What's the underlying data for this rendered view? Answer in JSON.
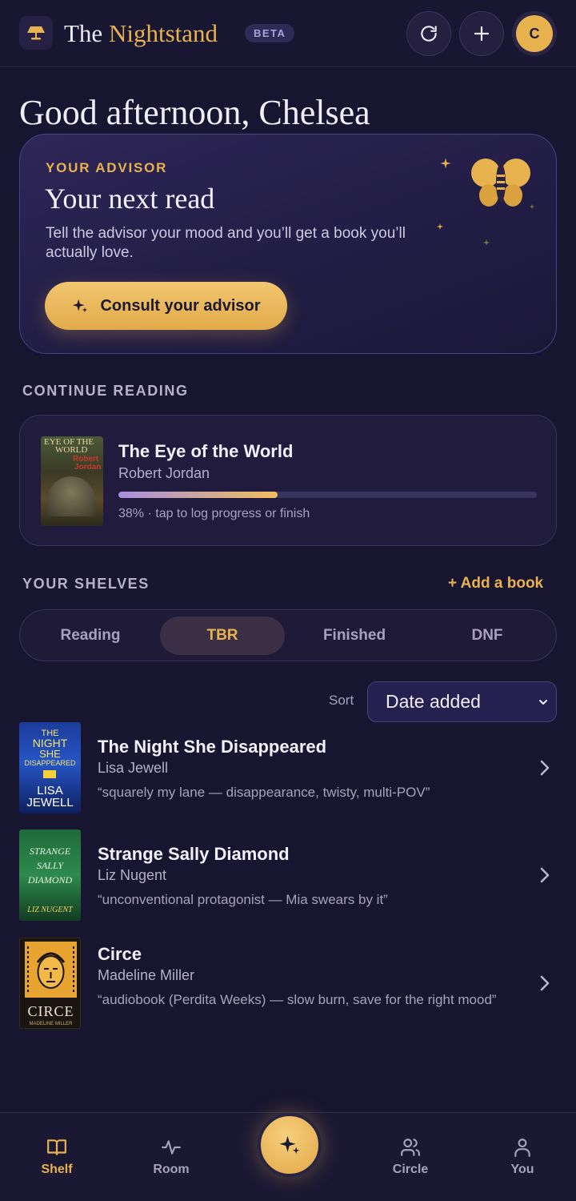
{
  "header": {
    "brand_prefix": "The",
    "brand_accent": "Nightstand",
    "badge": "BETA",
    "avatar_initial": "C",
    "icons": [
      "lamp-icon",
      "refresh-icon",
      "plus-icon"
    ]
  },
  "greeting": "Good afternoon, Chelsea",
  "advisor": {
    "eyebrow": "YOUR ADVISOR",
    "title": "Your next read",
    "description": "Tell the advisor your mood and you’ll get a book you’ll actually love.",
    "button_label": "Consult your advisor"
  },
  "continue_reading": {
    "section_label": "CONTINUE READING",
    "title": "The Eye of the World",
    "author": "Robert Jordan",
    "progress": 0.38,
    "note": "38% · tap to log progress or finish",
    "cover_text": [
      "EYE OF THE",
      "WORLD",
      "Robert",
      "Jordan"
    ]
  },
  "shelves": {
    "section_label": "YOUR SHELVES",
    "add_label": "+ Add a book",
    "tabs": [
      "Reading",
      "TBR",
      "Finished",
      "DNF"
    ],
    "active_tab": "TBR",
    "sort_label": "Sort",
    "sort_value": "Date added",
    "books": [
      {
        "title": "The Night She Disappeared",
        "author": "Lisa Jewell",
        "note": "“squarely my lane — disappearance, twisty, multi-POV”",
        "cover_text": [
          "THE",
          "NIGHT",
          "SHE",
          "DISAPPEARED",
          "LISA",
          "JEWELL"
        ]
      },
      {
        "title": "Strange Sally Diamond",
        "author": "Liz Nugent",
        "note": "“unconventional protagonist — Mia swears by it”",
        "cover_text": [
          "STRANGE",
          "SALLY",
          "DIAMOND",
          "LIZ NUGENT"
        ]
      },
      {
        "title": "Circe",
        "author": "Madeline Miller",
        "note": "“audiobook (Perdita Weeks) — slow burn, save for the right mood”",
        "cover_text": [
          "CIRCE",
          "MADELINE MILLER"
        ]
      }
    ]
  },
  "nav": {
    "items": [
      {
        "label": "Shelf",
        "icon": "book-icon",
        "active": true
      },
      {
        "label": "Room",
        "icon": "activity-icon",
        "active": false
      },
      {
        "label": "Circle",
        "icon": "people-icon",
        "active": false
      },
      {
        "label": "You",
        "icon": "user-icon",
        "active": false
      }
    ]
  },
  "colors": {
    "background": "#181530",
    "accent": "#e8b24f",
    "card": "#211c3e",
    "purple": "#a78fe0"
  }
}
